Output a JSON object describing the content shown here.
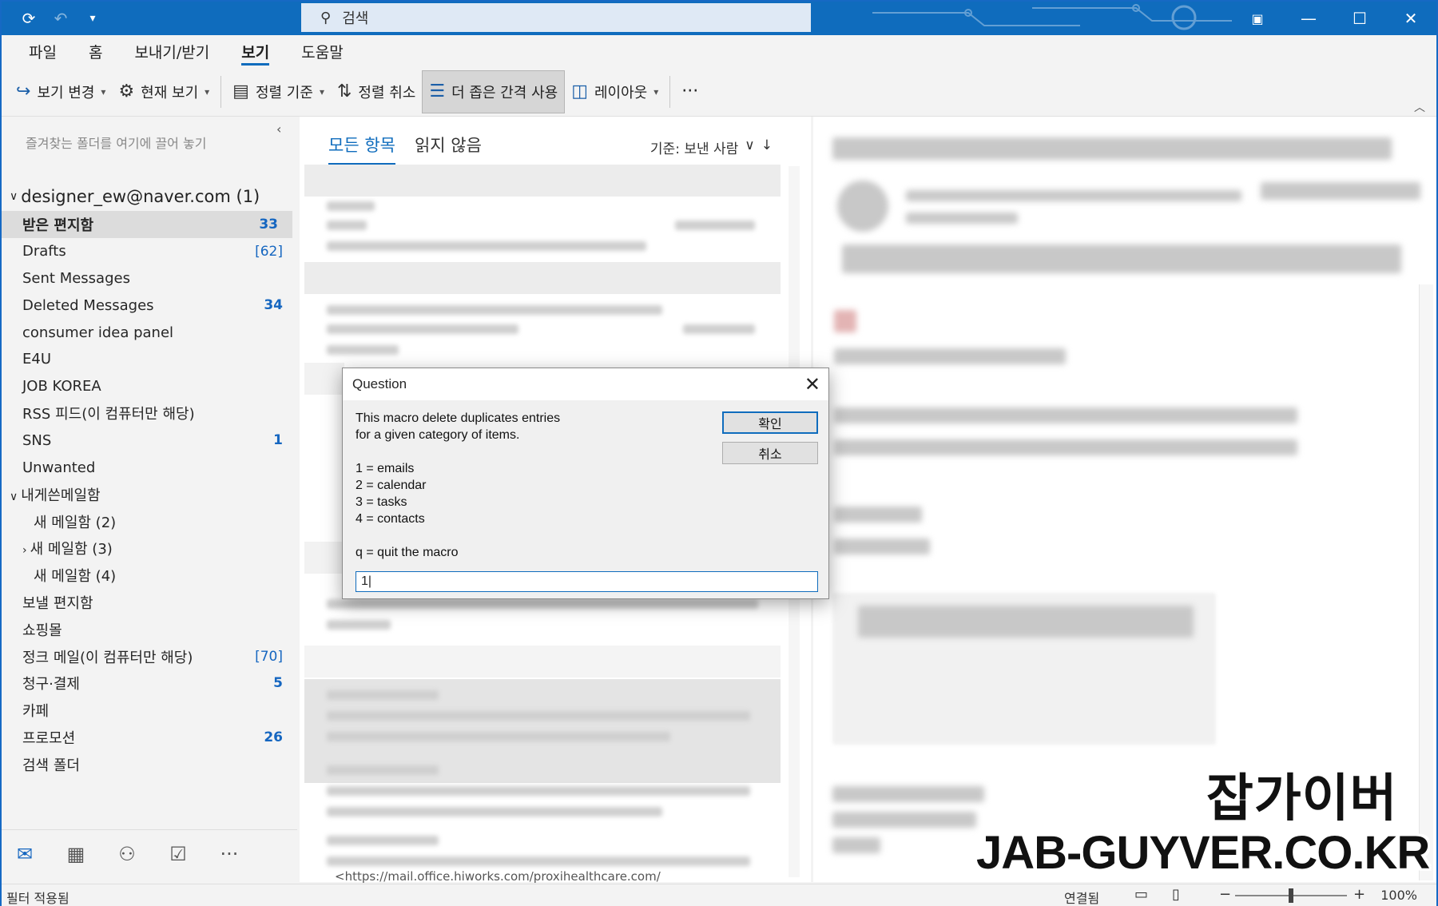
{
  "titlebar": {
    "search_placeholder": "검색",
    "colors": {
      "accent": "#0f6cbd"
    }
  },
  "menu_tabs": [
    {
      "label": "파일"
    },
    {
      "label": "홈"
    },
    {
      "label": "보내기/받기"
    },
    {
      "label": "보기",
      "active": true
    },
    {
      "label": "도움말"
    }
  ],
  "ribbon": {
    "change_view": "보기 변경",
    "current_view": "현재 보기",
    "sort_by": "정렬 기준",
    "sort_cancel": "정렬 취소",
    "tighter_spacing": "더 좁은 간격 사용",
    "layout": "레이아웃",
    "more": "···"
  },
  "folder_pane": {
    "favorites_hint": "즐겨찾는 폴더를 여기에 끌어 놓기",
    "account": "designer_ew@naver.com (1)",
    "folders": [
      {
        "label": "받은 편지함",
        "count": "33",
        "selected": true
      },
      {
        "label": "Drafts",
        "count": "[62]"
      },
      {
        "label": "Sent Messages",
        "count": ""
      },
      {
        "label": "Deleted Messages",
        "count": "34"
      },
      {
        "label": "consumer idea panel",
        "count": ""
      },
      {
        "label": "E4U",
        "count": ""
      },
      {
        "label": "JOB KOREA",
        "count": ""
      },
      {
        "label": "RSS 피드(이 컴퓨터만 해당)",
        "count": ""
      },
      {
        "label": "SNS",
        "count": "1"
      },
      {
        "label": "Unwanted",
        "count": ""
      },
      {
        "label": "내게쓴메일함",
        "count": "",
        "group": true
      },
      {
        "label": "새 메일함 (2)",
        "count": "",
        "sub": true
      },
      {
        "label": "새 메일함 (3)",
        "count": "",
        "sub": true,
        "expandable": true
      },
      {
        "label": "새 메일함 (4)",
        "count": "",
        "sub": true
      },
      {
        "label": "보낼 편지함",
        "count": ""
      },
      {
        "label": "쇼핑몰",
        "count": ""
      },
      {
        "label": "정크 메일(이 컴퓨터만 해당)",
        "count": "[70]"
      },
      {
        "label": "청구·결제",
        "count": "5"
      },
      {
        "label": "카페",
        "count": ""
      },
      {
        "label": "프로모션",
        "count": "26"
      },
      {
        "label": "검색 폴더",
        "count": ""
      }
    ]
  },
  "message_list": {
    "tab_all": "모든 항목",
    "tab_unread": "읽지 않음",
    "sort_label": "기준: 보낸 사람",
    "bottom_link": "<https://mail.office.hiworks.com/proxihealthcare.com/"
  },
  "dialog": {
    "title": "Question",
    "prompt": "This macro delete duplicates entries\nfor a given category of items.\n\n1 = emails\n2 = calendar\n3 = tasks\n4 = contacts\n\nq = quit the macro",
    "ok": "확인",
    "cancel": "취소",
    "input_value": "1|"
  },
  "statusbar": {
    "filter": "필터 적용됨",
    "connection": "연결됨",
    "zoom": "100%",
    "zoom_level": 0.5
  },
  "watermark": {
    "korean": "잡가이버",
    "english": "JAB-GUYVER.CO.KR"
  }
}
